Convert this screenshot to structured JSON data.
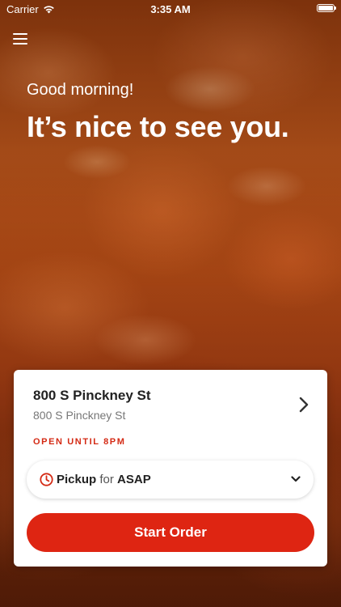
{
  "status_bar": {
    "carrier": "Carrier",
    "time": "3:35 AM",
    "battery_level": 1.0
  },
  "header": {
    "greeting": "Good morning!",
    "headline": "It’s nice to see you."
  },
  "location_card": {
    "store_name": "800 S Pinckney St",
    "store_address": "800 S Pinckney St",
    "open_status": "OPEN UNTIL 8PM",
    "order_type": {
      "mode": "Pickup",
      "connector": "for",
      "time": "ASAP"
    },
    "start_button_label": "Start Order"
  },
  "colors": {
    "accent": "#de2512",
    "open_status": "#d42a14"
  },
  "icons": {
    "menu": "hamburger-menu-icon",
    "wifi": "wifi-icon",
    "battery": "battery-icon",
    "store_chevron": "chevron-right-icon",
    "clock": "clock-icon",
    "dropdown": "chevron-down-icon"
  }
}
